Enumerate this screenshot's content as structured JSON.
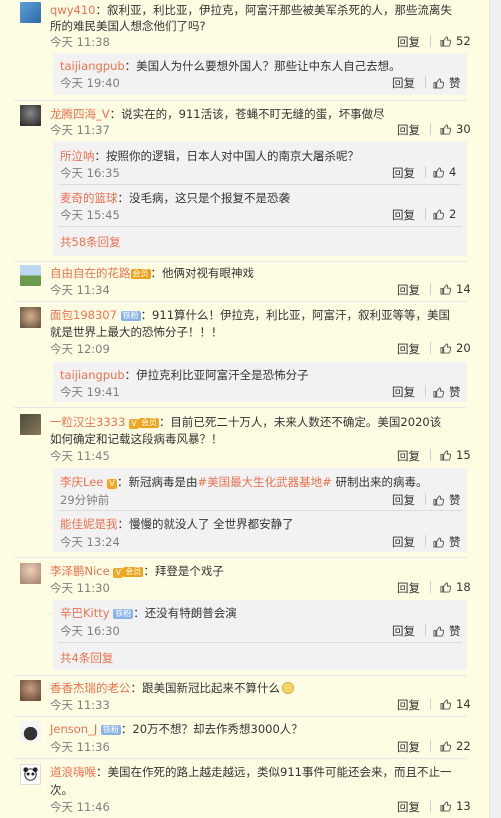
{
  "actions": {
    "reply": "回复",
    "like": "赞"
  },
  "comments": [
    {
      "name": "qwy410",
      "text_line1": "：叙利亚，利比亚，伊拉克，阿富汗那些被美军杀死的人，那些流离失",
      "text_line2": "所的难民美国人想念他们了吗?",
      "time": "今天 11:38",
      "likes": "52"
    },
    {
      "name": "taijiangpub",
      "text": "：美国人为什么要想外国人？那些让中东人自己去想。",
      "time": "今天 19:40"
    },
    {
      "name": "龙腾四海_V",
      "text": "：说实在的，911活该，苍蝇不盯无缝的蛋，坏事做尽",
      "time": "今天 11:37",
      "likes": "30"
    },
    {
      "name": "所泣呐",
      "text": "：按照你的逻辑，日本人对中国人的南京大屠杀呢？",
      "time": "今天 16:35",
      "likes": "4"
    },
    {
      "name": "麦奇的篮球",
      "text": "：没毛病，这只是个报复不是恐袭",
      "time": "今天 15:45",
      "likes": "2"
    },
    {
      "more": "共58条回复"
    },
    {
      "name": "自由自在的花路",
      "text": "：他俩对视有眼神戏",
      "time": "今天 11:34",
      "likes": "14"
    },
    {
      "name": "面包198307",
      "badge": "铁粉",
      "text_line1": "：911算什么！伊拉克，利比亚，阿富汗，叙利亚等等，美国",
      "text_line2": "就是世界上最大的恐怖分子！！！",
      "time": "今天 12:09",
      "likes": "20"
    },
    {
      "name": "taijiangpub",
      "text": "：伊拉克利比亚阿富汗全是恐怖分子",
      "time": "今天 19:41"
    },
    {
      "name": "一粒汉尘3333",
      "text_line1": "：目前已死二十万人，未来人数还不确定。美国2020该",
      "text_line2": "如何确定和记载这段病毒风暴？！",
      "time": "今天 11:45",
      "likes": "15"
    },
    {
      "name": "李庆Lee",
      "text_pre": "：新冠病毒是由",
      "tag": "#美国最大生化武器基地#",
      "text_post": " 研制出来的病毒。",
      "time": "29分钟前"
    },
    {
      "name": "能佳妮是我",
      "text": "：慢慢的就没人了 全世界都安静了",
      "time": "今天 13:24"
    },
    {
      "name": "李泽鹏Nice",
      "text": "：拜登是个戏子",
      "time": "今天 11:30",
      "likes": "18"
    },
    {
      "name": "辛巴Kitty",
      "badge": "铁粉",
      "text": "：还没有特朗普会演",
      "time": "今天 16:30"
    },
    {
      "more": "共4条回复"
    },
    {
      "name": "香香杰瑞的老公",
      "text": "：跟美国新冠比起来不算什么",
      "time": "今天 11:33",
      "likes": "14"
    },
    {
      "name": "Jenson_J",
      "badge": "铁粉",
      "text": "：20万不想？却去作秀想3000人？",
      "time": "今天 11:36",
      "likes": "22"
    },
    {
      "name": "道浪嗨喉",
      "text_line1": "：美国在作死的路上越走越远，类似911事件可能还会来，而且不止一",
      "text_line2": "次。",
      "time": "今天 11:46",
      "likes": "13"
    }
  ],
  "badges": {
    "member_label": "会员",
    "vip_label": "V"
  }
}
